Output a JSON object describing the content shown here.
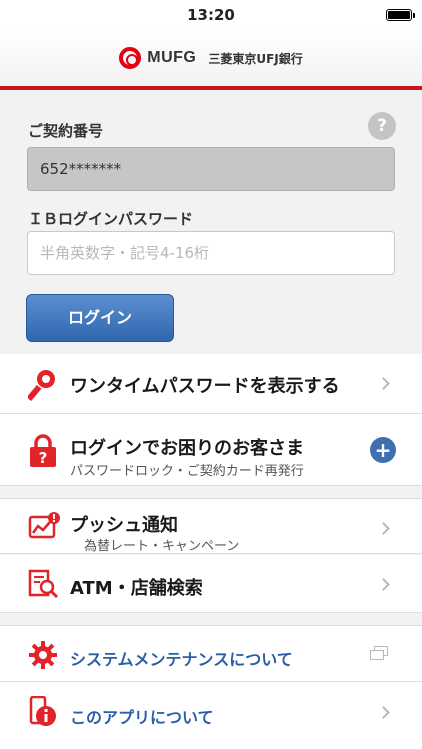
{
  "status_bar": {
    "time": "13:20"
  },
  "header": {
    "logo_text": "MUFG",
    "bank_name": "三菱東京UFJ銀行",
    "brand_color": "#e60012"
  },
  "login_form": {
    "contract_label": "ご契約番号",
    "contract_value": "652*******",
    "help_icon": "?",
    "password_label": "ＩＢログインパスワード",
    "password_placeholder": "半角英数字・記号4-16桁",
    "login_button": "ログイン"
  },
  "menu": [
    {
      "title": "ワンタイムパスワードを表示する",
      "icon": "key-icon"
    },
    {
      "title": "ログインでお困りのお客さま",
      "subtitle": "パスワードロック・ご契約カード再発行",
      "icon": "lock-help-icon",
      "action": "+"
    },
    {
      "title": "プッシュ通知",
      "subtitle": "為替レート・キャンペーン",
      "icon": "push-chart-icon"
    },
    {
      "title": "ATM・店舗検索",
      "icon": "atm-search-icon"
    },
    {
      "title": "システムメンテナンスについて",
      "icon": "gear-icon"
    },
    {
      "title": "このアプリについて",
      "icon": "info-phone-icon"
    }
  ],
  "colors": {
    "accent_red": "#c8161d",
    "link_blue": "#2b5ea6",
    "button_blue": "#3e6fb0"
  }
}
